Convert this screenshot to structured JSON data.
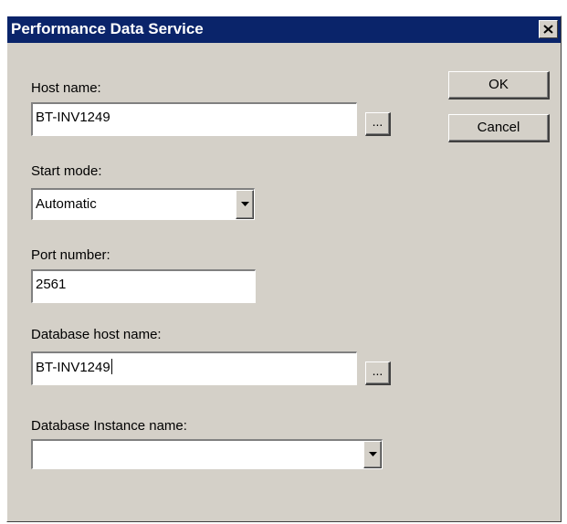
{
  "window": {
    "title": "Performance Data Service",
    "close_icon": "close-x"
  },
  "form": {
    "host_name": {
      "label": "Host name:",
      "value": "BT-INV1249",
      "browse_label": "..."
    },
    "start_mode": {
      "label": "Start mode:",
      "value": "Automatic"
    },
    "port_number": {
      "label": "Port number:",
      "value": "2561"
    },
    "db_host_name": {
      "label": "Database host name:",
      "value": "BT-INV1249",
      "browse_label": "..."
    },
    "db_instance_name": {
      "label": "Database Instance name:",
      "value": ""
    }
  },
  "buttons": {
    "ok": "OK",
    "cancel": "Cancel"
  },
  "colors": {
    "titlebar": "#0a246a",
    "dialog_face": "#d4d0c8"
  }
}
